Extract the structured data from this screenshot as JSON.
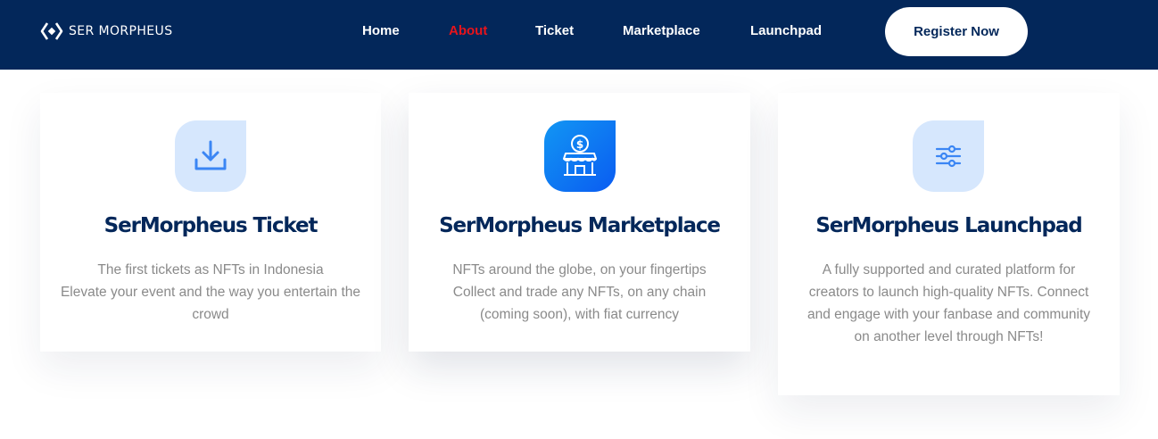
{
  "brand": {
    "name": "SER MORPHEUS"
  },
  "nav": {
    "links": [
      {
        "label": "Home",
        "active": false
      },
      {
        "label": "About",
        "active": true
      },
      {
        "label": "Ticket",
        "active": false
      },
      {
        "label": "Marketplace",
        "active": false
      },
      {
        "label": "Launchpad",
        "active": false
      }
    ],
    "cta": "Register Now"
  },
  "cards": [
    {
      "icon": "download-icon",
      "title": "SerMorpheus Ticket",
      "lines": [
        "The first tickets as NFTs in Indonesia",
        "Elevate your event and the way you entertain the",
        "crowd"
      ]
    },
    {
      "icon": "shop-icon",
      "title": "SerMorpheus Marketplace",
      "lines": [
        "NFTs around the globe, on your fingertips",
        "Collect and trade any NFTs, on any chain",
        "(coming soon), with fiat currency"
      ]
    },
    {
      "icon": "sliders-icon",
      "title": "SerMorpheus Launchpad",
      "lines": [
        "A fully supported and curated platform for",
        "creators to launch high-quality NFTs. Connect",
        "and engage with your fanbase and community",
        "on another level through NFTs!"
      ]
    }
  ],
  "colors": {
    "navbar": "#03275a",
    "active_link": "#e8141b",
    "title": "#03275a",
    "body_text": "#8a8a8a",
    "icon_tint": "#d6e7fd",
    "icon_accent": "#3b86f4"
  }
}
